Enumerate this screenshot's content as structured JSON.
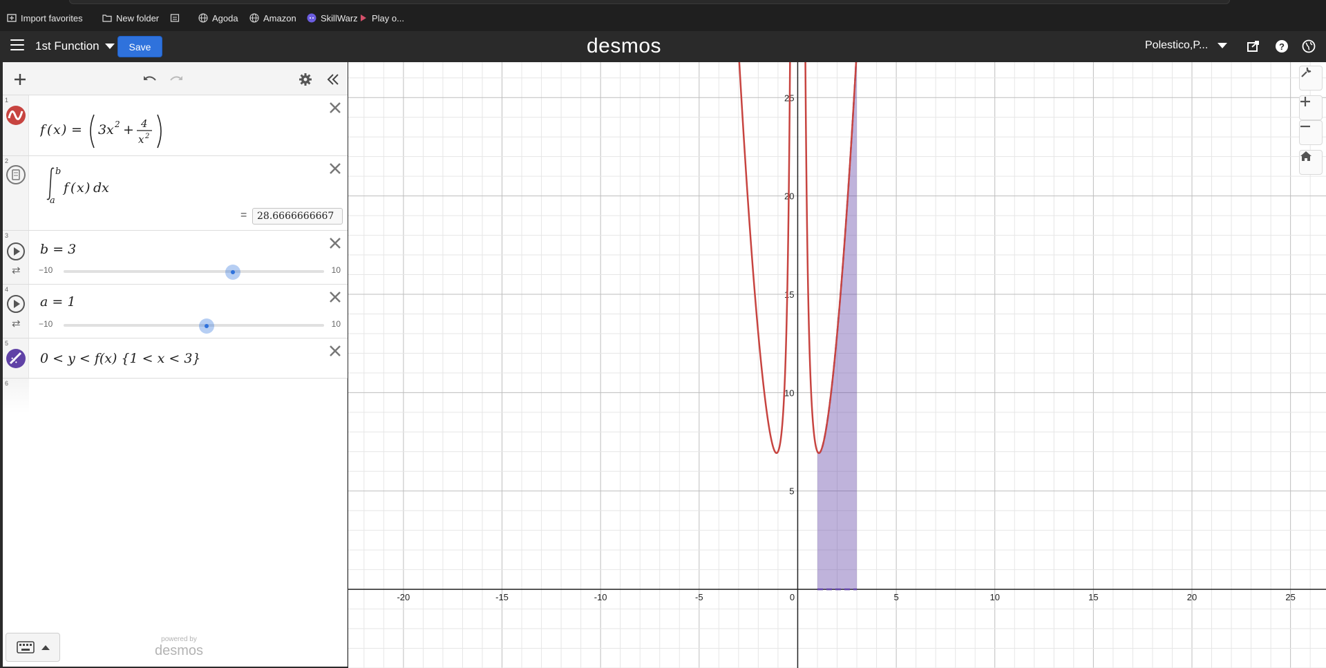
{
  "bookmarks": [
    {
      "label": "Import favorites",
      "icon": "import-icon"
    },
    {
      "label": "New folder",
      "icon": "folder-icon"
    },
    {
      "label": "",
      "icon": "calendar-icon"
    },
    {
      "label": "Agoda",
      "icon": "globe-icon"
    },
    {
      "label": "Amazon",
      "icon": "globe-icon"
    },
    {
      "label": "SkillWarz",
      "icon": "discord-icon"
    },
    {
      "label": "Play o...",
      "icon": "play-icon"
    }
  ],
  "header": {
    "title": "1st Function",
    "save_label": "Save",
    "logo": "desmos",
    "user": "Polestico,P..."
  },
  "expressions": [
    {
      "num": "1",
      "latex": "f(x) = (3x^2 + 4/x^2)",
      "color": "#c74440"
    },
    {
      "num": "2",
      "latex": "∫_a^b f(x) dx",
      "result": "28.6666666667"
    },
    {
      "num": "3",
      "latex": "b = 3",
      "slider": {
        "min": "−10",
        "max": "10",
        "value": 3
      }
    },
    {
      "num": "4",
      "latex": "a = 1",
      "slider": {
        "min": "−10",
        "max": "10",
        "value": 1
      }
    },
    {
      "num": "5",
      "latex": "0 < y < f(x) {1 < x < 3}",
      "color": "#6042a6"
    },
    {
      "num": "6",
      "latex": ""
    }
  ],
  "powered_by": {
    "small": "powered by",
    "big": "desmos"
  },
  "chart_data": {
    "type": "line",
    "x_ticks": [
      "-20",
      "-15",
      "-10",
      "-5",
      "0",
      "5",
      "10",
      "15",
      "20",
      "25"
    ],
    "y_ticks": [
      "5",
      "10",
      "15",
      "20",
      "25"
    ],
    "xlim": [
      -22.8,
      26.8
    ],
    "ylim": [
      -4,
      26.8
    ],
    "series": [
      {
        "expression": "f(x) = 3x^2 + 4/x^2",
        "color": "#c74440"
      },
      {
        "expression": "0 < y < f(x) {1 < x < 3}",
        "color": "#6042a6",
        "fill": true
      }
    ],
    "grid": true
  }
}
